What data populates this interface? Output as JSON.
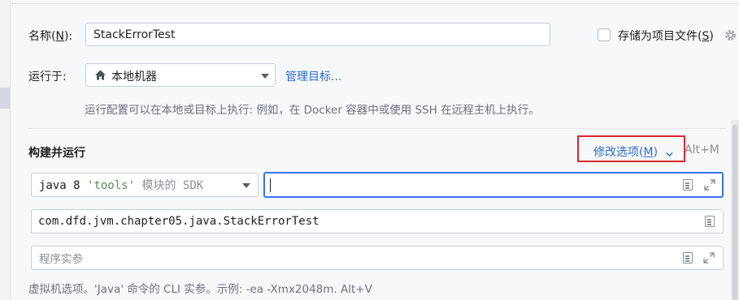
{
  "name_row": {
    "label_prefix": "名称(",
    "label_mnemonic": "N",
    "label_suffix": "):",
    "value": "StackErrorTest",
    "store_as_project_file_prefix": "存储为项目文件(",
    "store_as_project_file_mnemonic": "S",
    "store_as_project_file_suffix": ")",
    "store_as_project_file_checked": false
  },
  "run_on_row": {
    "label": "运行于:",
    "target_value": "本地机器",
    "target_icon": "home-icon",
    "manage_targets_link": "管理目标...",
    "hint": "运行配置可以在本地或目标上执行: 例如，在 Docker 容器中或使用 SSH 在远程主机上执行。"
  },
  "build_run_section": {
    "title": "构建并运行",
    "modify_options_prefix": "修改选项(",
    "modify_options_mnemonic": "M",
    "modify_options_suffix": ")",
    "modify_options_shortcut": "Alt+M",
    "highlight_color": "#d9282f",
    "sdk_select": {
      "prefix": "java 8",
      "module": "'tools'",
      "suffix": "模块的 SDK"
    },
    "program_args_value": "",
    "main_class_value": "com.dfd.jvm.chapter05.java.StackErrorTest",
    "program_params_placeholder": "程序实参",
    "vm_options_hint": "虚拟机选项。'Java' 命令的 CLI 实参。示例: -ea -Xmx2048m. Alt+V"
  },
  "colors": {
    "accent_link": "#2c6ccf",
    "focus_border": "#3574f0",
    "background": "#f7f8fa"
  }
}
